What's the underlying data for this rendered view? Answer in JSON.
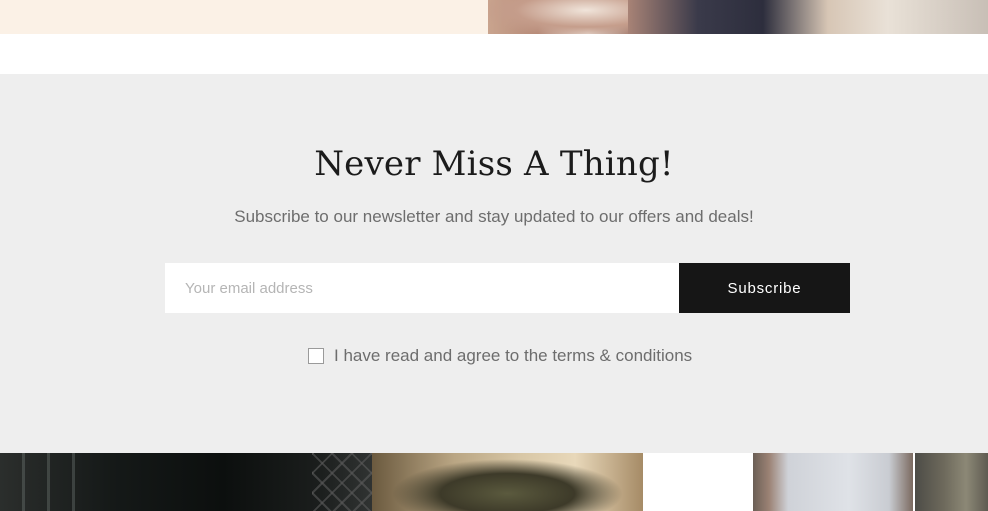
{
  "newsletter": {
    "title": "Never Miss A Thing!",
    "subtitle": "Subscribe to our newsletter and stay updated to our offers and deals!",
    "email_placeholder": "Your email address",
    "email_value": "",
    "subscribe_label": "Subscribe",
    "terms_label": "I have read and agree to the terms & conditions",
    "terms_checked": false
  },
  "colors": {
    "section_background": "#eeeeee",
    "button_background": "#161616",
    "button_text": "#ffffff",
    "title_text": "#1b1b1b",
    "body_text": "#6d6d6d"
  }
}
